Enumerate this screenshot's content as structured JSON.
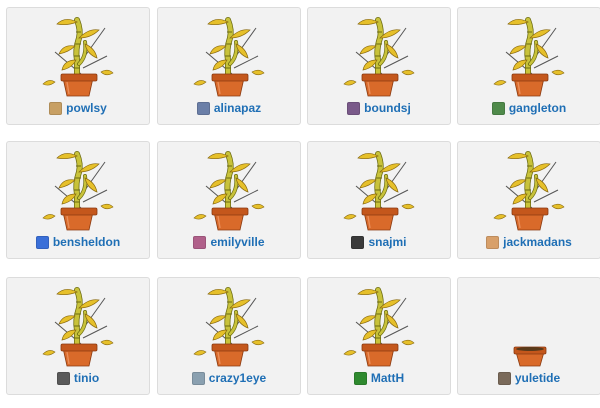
{
  "colors": {
    "link": "#1f6fb5",
    "card_bg": "#f2f2f2",
    "card_border": "#dcdcdc",
    "pot": "#d96a2a",
    "pot_rim": "#c4571c",
    "stalk": "#c8c23a",
    "leaf": "#e6c02a"
  },
  "users": [
    {
      "name": "powlsy",
      "plant": "bamboo",
      "avatar_color": "#c8a064",
      "avatar_icon": "fox-avatar-icon"
    },
    {
      "name": "alinapaz",
      "plant": "bamboo",
      "avatar_color": "#6b7fa8",
      "avatar_icon": "photo-avatar-icon"
    },
    {
      "name": "boundsj",
      "plant": "bamboo",
      "avatar_color": "#7a5a8a",
      "avatar_icon": "photo-avatar-icon"
    },
    {
      "name": "gangleton",
      "plant": "bamboo",
      "avatar_color": "#4f8a4a",
      "avatar_icon": "photo-avatar-icon"
    },
    {
      "name": "bensheldon",
      "plant": "bamboo",
      "avatar_color": "#3a6fd8",
      "avatar_icon": "badge-avatar-icon"
    },
    {
      "name": "emilyville",
      "plant": "bamboo",
      "avatar_color": "#b0608a",
      "avatar_icon": "photo-avatar-icon"
    },
    {
      "name": "snajmi",
      "plant": "bamboo",
      "avatar_color": "#3a3a3a",
      "avatar_icon": "photo-avatar-icon"
    },
    {
      "name": "jackmadans",
      "plant": "bamboo",
      "avatar_color": "#d8a06a",
      "avatar_icon": "photo-avatar-icon"
    },
    {
      "name": "tinio",
      "plant": "bamboo",
      "avatar_color": "#5a5a5a",
      "avatar_icon": "photo-avatar-icon"
    },
    {
      "name": "crazy1eye",
      "plant": "bamboo",
      "avatar_color": "#8aa0b0",
      "avatar_icon": "photo-avatar-icon"
    },
    {
      "name": "MattH",
      "plant": "bamboo",
      "avatar_color": "#2f8a2f",
      "avatar_icon": "green-square-avatar-icon"
    },
    {
      "name": "yuletide",
      "plant": "empty-pot",
      "avatar_color": "#7a6a5a",
      "avatar_icon": "photo-avatar-icon"
    }
  ]
}
